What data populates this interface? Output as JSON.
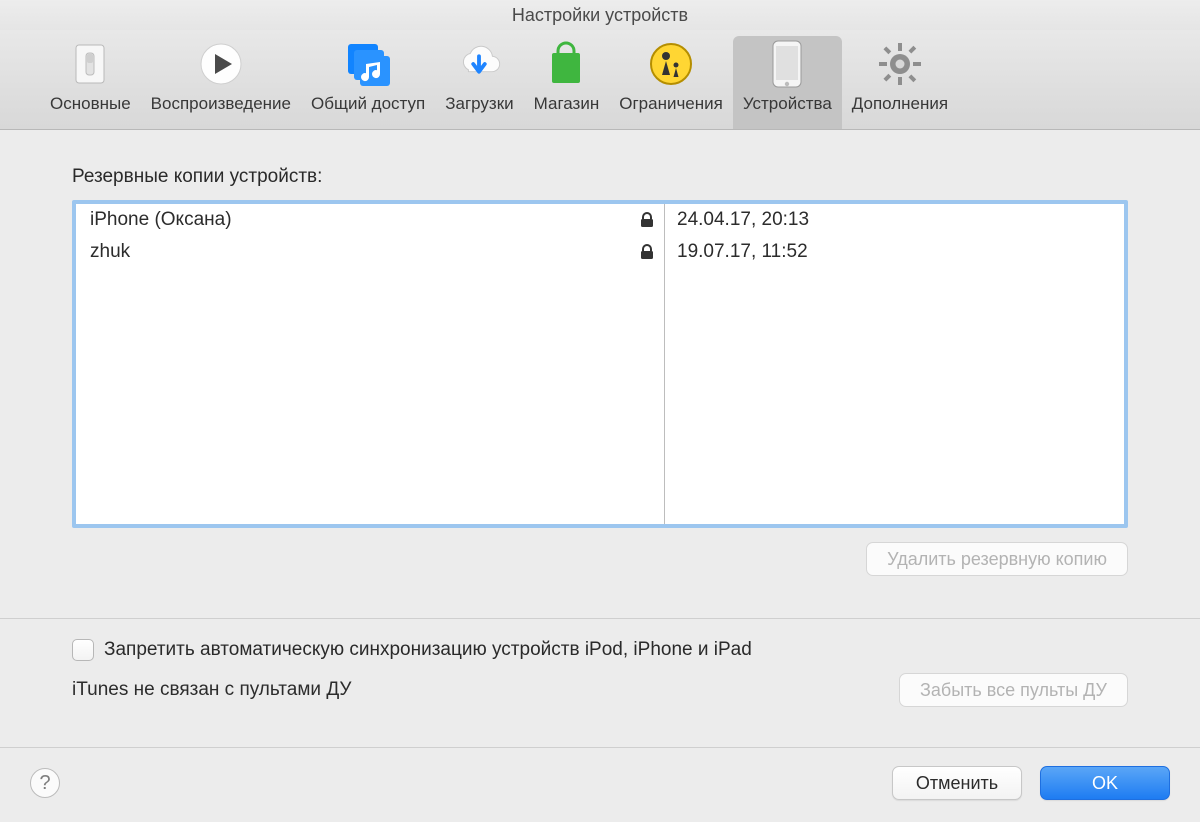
{
  "window": {
    "title": "Настройки устройств"
  },
  "toolbar": {
    "tabs": [
      {
        "label": "Основные"
      },
      {
        "label": "Воспроизведение"
      },
      {
        "label": "Общий доступ"
      },
      {
        "label": "Загрузки"
      },
      {
        "label": "Магазин"
      },
      {
        "label": "Ограничения"
      },
      {
        "label": "Устройства"
      },
      {
        "label": "Дополнения"
      }
    ],
    "active_index": 6
  },
  "backups": {
    "heading": "Резервные копии устройств:",
    "rows": [
      {
        "device": "iPhone (Оксана)",
        "locked": true,
        "date": "24.04.17, 20:13"
      },
      {
        "device": "zhuk",
        "locked": true,
        "date": "19.07.17, 11:52"
      }
    ],
    "delete_button": "Удалить резервную копию"
  },
  "sync": {
    "checkbox_label": "Запретить автоматическую синхронизацию устройств iPod, iPhone и iPad",
    "checked": false,
    "remote_status": "iTunes не связан с пультами ДУ",
    "forget_button": "Забыть все пульты ДУ"
  },
  "footer": {
    "help": "?",
    "cancel": "Отменить",
    "ok": "OK"
  }
}
